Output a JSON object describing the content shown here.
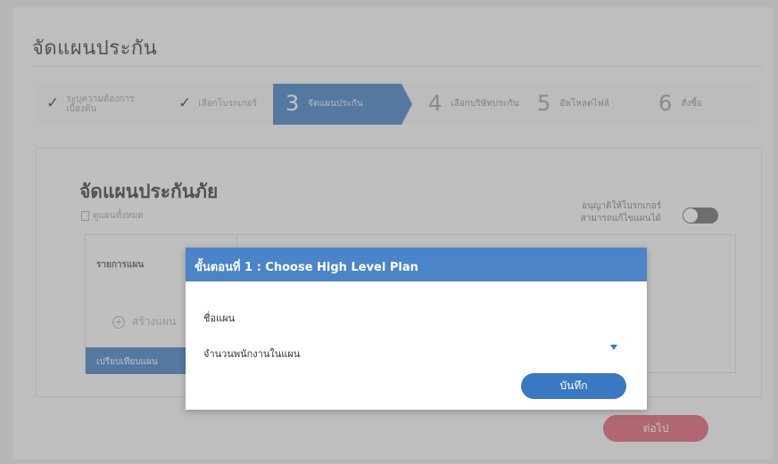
{
  "page": {
    "title": "จัดแผนประกัน"
  },
  "stepper": {
    "steps": [
      {
        "label": "ระบุความต้องการเบื้องต้น",
        "state": "done"
      },
      {
        "label": "เลือกโบรกเกอร์",
        "state": "done"
      },
      {
        "number": "3",
        "label": "จัดแผนประกัน",
        "state": "active"
      },
      {
        "number": "4",
        "label": "เลือกบริษัทประกัน",
        "state": "pending"
      },
      {
        "number": "5",
        "label": "อัพโหลดไฟล์",
        "state": "pending"
      },
      {
        "number": "6",
        "label": "สั่งซื้อ",
        "state": "pending"
      }
    ]
  },
  "card": {
    "title": "จัดแผนประกันภัย",
    "view_all": "ดูแผนทั้งหมด",
    "allow_broker_line1": "อนุญาติให้โบรกเกอร์",
    "allow_broker_line2": "สามารถแก้ไขแผนได้",
    "plan_list_header": "รายการแผน",
    "create_plan": "สร้างแผน",
    "compare_plans": "เปรียบเทียบแผน"
  },
  "next_button": "ต่อไป",
  "modal": {
    "title": "ขั้นตอนที่ 1 : Choose High Level Plan",
    "plan_name_label": "ชื่อแผน",
    "employee_count_label": "จำนวนพนักงานในแผน",
    "save_button": "บันทึก"
  },
  "colors": {
    "primary": "#3a79c1",
    "modal_header": "#4b84c7",
    "next_button": "#e05a6e"
  }
}
